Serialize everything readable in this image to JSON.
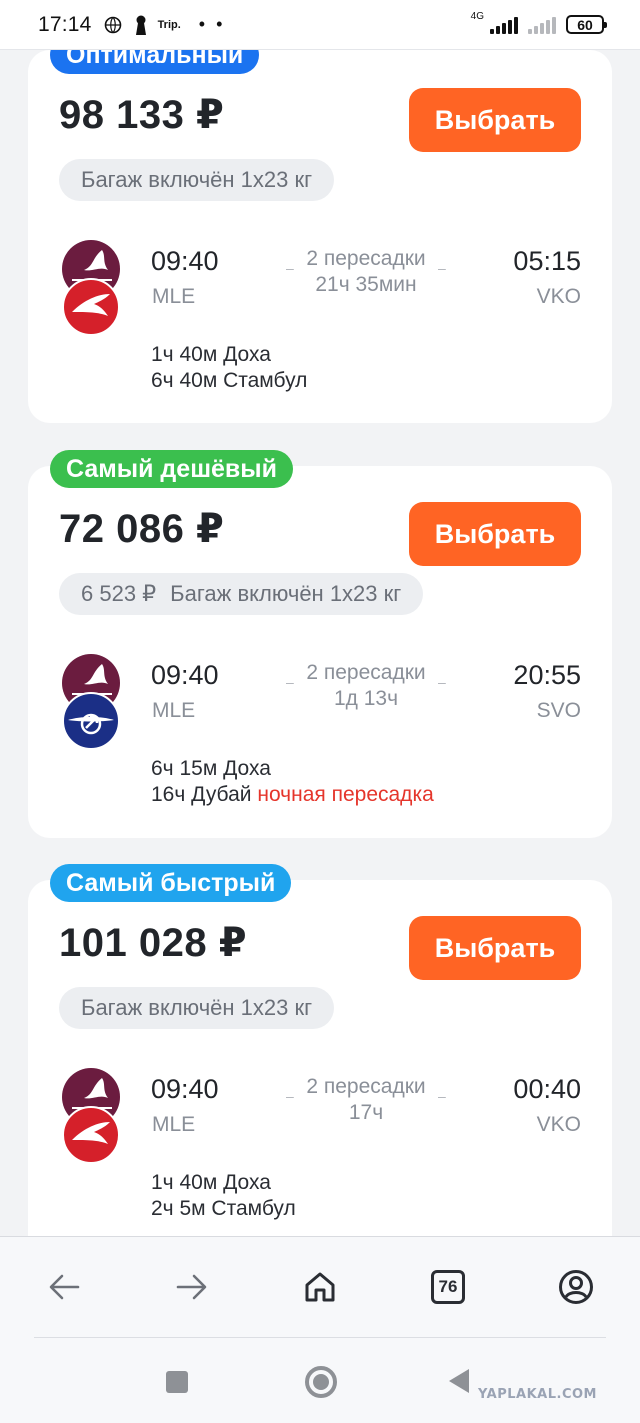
{
  "status": {
    "time": "17:14",
    "app_label": "Trip.",
    "dots": "• •",
    "network": "4G",
    "battery": "60"
  },
  "offers": [
    {
      "badge": "Оптимальный",
      "badge_color": "#1b73f0",
      "price": "98 133 ₽",
      "select_label": "Выбрать",
      "old_price": "",
      "baggage": "Багаж включён 1х23 кг",
      "airlines": [
        "qatar-airways-logo",
        "turkish-airlines-logo"
      ],
      "dep_time": "09:40",
      "dep_airport": "MLE",
      "transfers": "2 пересадки",
      "duration": "21ч 35мин",
      "arr_time": "05:15",
      "arr_airport": "VKO",
      "stop1": "1ч 40м Доха",
      "stop2_text": "6ч 40м Стамбул",
      "stop2_note": ""
    },
    {
      "badge": "Самый дешёвый",
      "badge_color": "#3bbf4e",
      "price": "72 086 ₽",
      "select_label": "Выбрать",
      "old_price": "6 523 ₽",
      "baggage": "Багаж включён 1х23 кг",
      "airlines": [
        "qatar-airways-logo",
        "aeroflot-logo"
      ],
      "dep_time": "09:40",
      "dep_airport": "MLE",
      "transfers": "2 пересадки",
      "duration": "1д 13ч",
      "arr_time": "20:55",
      "arr_airport": "SVO",
      "stop1": "6ч 15м Доха",
      "stop2_text": "16ч Дубай",
      "stop2_note": "ночная пересадка"
    },
    {
      "badge": "Самый быстрый",
      "badge_color": "#20a4ee",
      "price": "101 028 ₽",
      "select_label": "Выбрать",
      "old_price": "",
      "baggage": "Багаж включён 1х23 кг",
      "airlines": [
        "qatar-airways-logo",
        "turkish-airlines-logo"
      ],
      "dep_time": "09:40",
      "dep_airport": "MLE",
      "transfers": "2 пересадки",
      "duration": "17ч",
      "arr_time": "00:40",
      "arr_airport": "VKO",
      "stop1": "1ч 40м Доха",
      "stop2_text": "2ч 5м Стамбул",
      "stop2_note": ""
    }
  ],
  "browser_nav": {
    "tab_count": "76"
  },
  "watermark": "YAPLAKAL.COM"
}
